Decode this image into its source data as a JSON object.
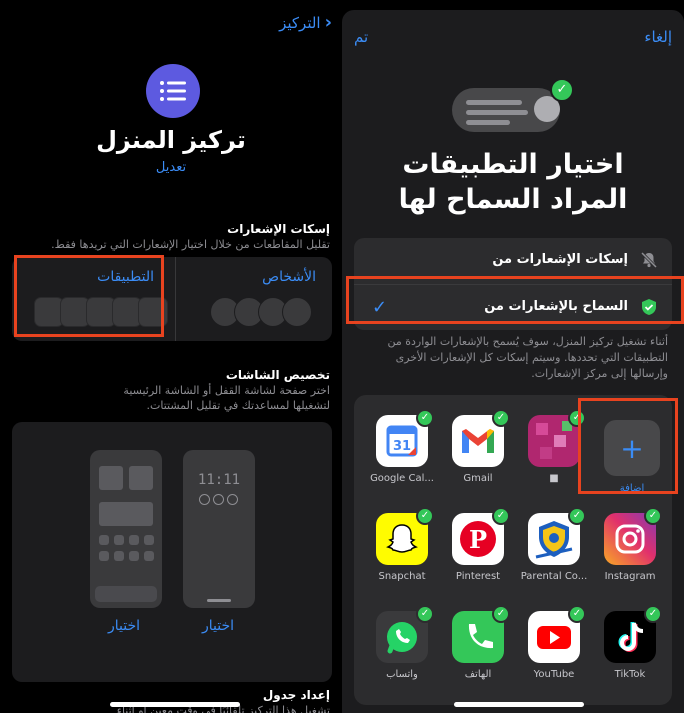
{
  "colors": {
    "accent": "#3b8cf5",
    "highlight": "#e8431f",
    "check": "#34c759",
    "focus_icon": "#5d5ae0"
  },
  "left": {
    "back_label": "التركيز",
    "focus_icon": "list-icon",
    "title": "تركيز المنزل",
    "edit_label": "تعديل",
    "silence": {
      "heading": "إسكات الإشعارات",
      "subtitle": "تقليل المقاطعات من خلال اختيار الإشعارات التي تريدها فقط.",
      "apps_label": "التطبيقات",
      "people_label": "الأشخاص"
    },
    "screens": {
      "heading": "تخصيص الشاشات",
      "subtitle": "اختر صفحة لشاشة القفل أو الشاشة الرئيسية لتشغيلها لمساعدتك في تقليل المشتتات.",
      "lock_time": "11:11",
      "choose_home": "اختيار",
      "choose_lock": "اختيار"
    },
    "schedule": {
      "heading": "إعداد جدول",
      "subtitle": "تشغيل هذا التركيز تلقائيًا في وقت معين أو أثناء"
    }
  },
  "right": {
    "cancel_label": "إلغاء",
    "done_label": "تم",
    "title_line1": "اختيار التطبيقات",
    "title_line2": "المراد السماح لها",
    "options": [
      {
        "label": "إسكات الإشعارات من",
        "icon": "bell-slash-icon",
        "selected": false
      },
      {
        "label": "السماح بالإشعارات من",
        "icon": "shield-check-icon",
        "selected": true
      }
    ],
    "description": "أثناء تشغيل تركيز المنزل، سوف يُسمح بالإشعارات الواردة من التطبيقات التي تحددها. وسيتم إسكات كل الإشعارات الأخرى وإرسالها إلى مركز الإشعارات.",
    "add_label": "إضافة",
    "apps": [
      {
        "name": "Google Cal...",
        "icon": "google-calendar-icon"
      },
      {
        "name": "Gmail",
        "icon": "gmail-icon"
      },
      {
        "name": "■",
        "icon": "blurred-app-icon"
      },
      {
        "name": "Snapchat",
        "icon": "snapchat-icon"
      },
      {
        "name": "Pinterest",
        "icon": "pinterest-icon"
      },
      {
        "name": "Parental Co...",
        "icon": "parental-control-icon"
      },
      {
        "name": "Instagram",
        "icon": "instagram-icon"
      },
      {
        "name": "واتساب",
        "icon": "whatsapp-icon"
      },
      {
        "name": "الهاتف",
        "icon": "phone-icon"
      },
      {
        "name": "YouTube",
        "icon": "youtube-icon"
      },
      {
        "name": "TikTok",
        "icon": "tiktok-icon"
      }
    ]
  }
}
